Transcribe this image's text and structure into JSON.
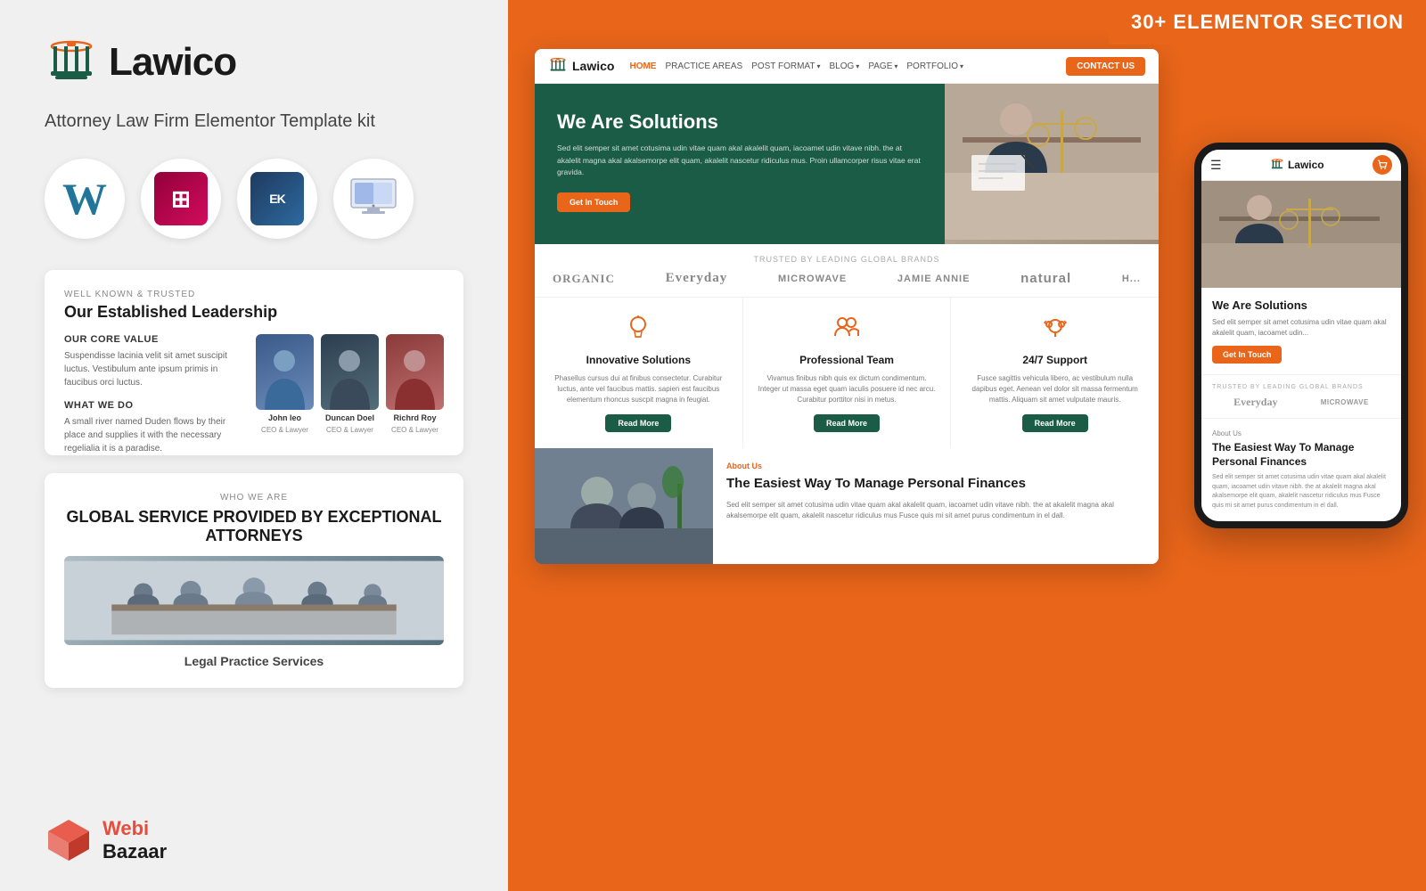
{
  "left": {
    "logo_text": "Lawico",
    "tagline": "Attorney Law Firm Elementor Template kit",
    "tech_icons": [
      {
        "name": "WordPress",
        "type": "wp"
      },
      {
        "name": "Elementor",
        "type": "el"
      },
      {
        "name": "EK",
        "type": "ek"
      },
      {
        "name": "Monitor",
        "type": "monitor"
      }
    ],
    "leadership_card": {
      "well_known_tag": "WELL KNOWN & TRUSTED",
      "title": "Our Established Leadership",
      "core_value_title": "OUR CORE VALUE",
      "core_value_text": "Suspendisse lacinia velit sit amet suscipit luctus. Vestibulum ante ipsum primis in faucibus orci luctus.",
      "what_we_do_title": "WHAT WE DO",
      "what_we_do_text": "A small river named Duden flows by their place and supplies it with the necessary regelialia it is a paradise.",
      "team_members": [
        {
          "name": "John leo",
          "role": "CEO & Lawyer"
        },
        {
          "name": "Duncan Doel",
          "role": "CEO & Lawyer"
        },
        {
          "name": "Richrd Roy",
          "role": "CEO & Lawyer"
        }
      ]
    },
    "global_service": {
      "who_we_are_tag": "WHO WE ARE",
      "title": "GLOBAL SERVICE PROVIDED BY EXCEPTIONAL ATTORNEYS",
      "legal_label": "Legal Practice Services"
    },
    "webibazaar": {
      "webi": "Webi",
      "bazaar": "Bazaar"
    }
  },
  "right": {
    "badge": "30+ ELEMENTOR SECTION",
    "desktop_nav": {
      "logo": "Lawico",
      "links": [
        {
          "label": "HOME",
          "active": true
        },
        {
          "label": "PRACTICE AREAS",
          "active": false
        },
        {
          "label": "POST FORMAT",
          "active": false,
          "dropdown": true
        },
        {
          "label": "BLOG",
          "active": false,
          "dropdown": true
        },
        {
          "label": "PAGE",
          "active": false,
          "dropdown": true
        },
        {
          "label": "PORTFOLIO",
          "active": false,
          "dropdown": true
        }
      ],
      "contact_btn": "CONTACT US"
    },
    "hero": {
      "title": "We Are Solutions",
      "description": "Sed elit semper sit amet cotusima udin vitae quam akal akalelit quam, iacoamet udin vitave nibh. the at akalelit magna akal akalsemorpe elit quam, akalelit nascetur ridiculus mus. Proin ullamcorper risus vitae erat gravida.",
      "btn": "Get In Touch"
    },
    "brands_section": {
      "label": "TRUSTED BY LEADING GLOBAL BRANDS",
      "brands": [
        "ORGANIC",
        "Everyday",
        "MICROWAVE",
        "JAMIE ANNIE",
        "natural",
        "H..."
      ]
    },
    "services": [
      {
        "icon": "💡",
        "title": "Innovative Solutions",
        "desc": "Phasellus cursus dui at finibus consectetur. Curabitur luctus, ante vel faucibus mattis. sapien est faucibus elementum rhoncus suscpit magna in feugiat.",
        "btn": "Read More"
      },
      {
        "icon": "👥",
        "title": "Professional Team",
        "desc": "Vivamus finibus nibh quis ex dictum condimentum. Integer ut massa eget quam iaculis posuere id nec arcu. Curabitur porttitor nisi in metus.",
        "btn": "Read More"
      },
      {
        "icon": "🎧",
        "title": "24/7 Support",
        "desc": "Fusce sagittis vehicula libero, ac vestibulum nulla dapibus eget. Aenean vel dolor sit massa fermentum mattis. Aliquam sit amet vulputate mauris.",
        "btn": "Read More"
      }
    ],
    "about": {
      "tag": "About Us",
      "title": "The Easiest Way To Manage Personal Finances",
      "desc": "Sed elit semper sit amet cotusima udin vitae quam akal akalelit quam, iacoamet udin vitave nibh. the at akalelit magna akal akalsemorpe elit quam, akalelit nascetur ridiculus mus Fusce quis mi sit amet purus condimentum in el dall."
    }
  },
  "mobile": {
    "logo": "Lawico",
    "hero_title": "We Are Solutions",
    "hero_desc": "Sed elit semper sit amet cotusima udin vitae quam akal akalelit quam, iacoamet udin...",
    "hero_btn": "Get In Touch",
    "brands_label": "TRUSTED BY LEADING GLOBAL BRANDS",
    "brands": [
      "Everyday",
      "MICROWAVE"
    ],
    "about_tag": "About Us",
    "about_title": "The Easiest Way To Manage Personal Finances",
    "about_desc": "Sed elit semper sit amet cotusima udin vitae quam akal akalelit quam, iacoamet udin vitave nibh. the at akalelit magna akal akalsemorpe elit quam, akalelit nascetur ridiculus mus Fusce quis mi sit amet purus condimentum in el dall."
  }
}
